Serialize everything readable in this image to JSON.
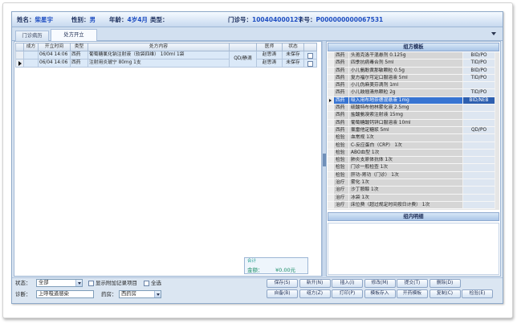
{
  "colors": {
    "accent": "#3774d2",
    "label_text": "#1c2f5e",
    "value_text": "#1f4fc2",
    "total_text": "#1a8d67",
    "window_bg": "#dbe6f2"
  },
  "icons": {
    "tab_menu": "chevron-down-icon",
    "current_row": "current-row-arrow-icon",
    "combo_arrow": "chevron-down-icon"
  },
  "patient": {
    "name_label": "姓名：",
    "name": "柴星宇",
    "gender_label": "性别：",
    "gender": "男",
    "age_label": "年龄：",
    "age": "4岁4月",
    "type_label": "类型：",
    "clinic_no_label": "门诊号：",
    "clinic_no": "100404000127",
    "card_no_label": "卡号：",
    "card_no": "P000000000067531"
  },
  "tabs": [
    {
      "label": "门诊病历",
      "active": false
    },
    {
      "label": "处方开立",
      "active": true
    }
  ],
  "orders": {
    "headers": {
      "set": "成方",
      "time": "开立时间",
      "type": "类型",
      "content": "处方内容",
      "doctor": "医师",
      "status": "状态"
    },
    "rows": [
      {
        "time": "06/04 14:06",
        "type": "西药",
        "content": "葡萄糖氯化钠注射液（软袋四维） 100ml 1袋",
        "usage": "QD/静滴",
        "doctor": "赵思涛",
        "status": "未保存",
        "checked": false,
        "current": false
      },
      {
        "time": "06/04 14:06",
        "type": "西药",
        "content": "注射用炎琥宁 80mg 1支",
        "doctor": "赵思涛",
        "status": "未保存",
        "checked": false,
        "current": true
      }
    ]
  },
  "total": {
    "title": "合计",
    "amount_label": "金额：",
    "amount": "¥0.00元"
  },
  "templates": {
    "title": "组方模板",
    "items": [
      {
        "type": "西药",
        "name": "头孢克洛干混悬剂 0.125g",
        "usage": "BID/PO"
      },
      {
        "type": "西药",
        "name": "四季抗病毒合剂 5ml",
        "usage": "TID/PO"
      },
      {
        "type": "西药",
        "name": "小儿氨酚黄那敏颗粒 0.5g",
        "usage": "BID/PO"
      },
      {
        "type": "西药",
        "name": "复方福尔可定口服溶液 5ml",
        "usage": "TID/PO"
      },
      {
        "type": "西药",
        "name": "小儿伪麻美芬滴剂 1ml"
      },
      {
        "type": "西药",
        "name": "小儿豉翘清热颗粒 2g",
        "usage": "TID/PO"
      },
      {
        "type": "西药",
        "name": "吸入用布地奈德混悬液 1mg",
        "usage": "BID/NEB",
        "selected": true
      },
      {
        "type": "西药",
        "name": "硫酸特布他林雾化液 2.5mg"
      },
      {
        "type": "西药",
        "name": "盐酸氨溴索注射液 15mg"
      },
      {
        "type": "西药",
        "name": "葡萄糖酸钙锌口服溶液 10ml"
      },
      {
        "type": "西药",
        "name": "氯雷他定糖浆 5ml",
        "usage": "QD/PO"
      },
      {
        "type": "检验",
        "name": "血常规 1次"
      },
      {
        "type": "检验",
        "name": "C-反应蛋白（CRP） 1次"
      },
      {
        "type": "检验",
        "name": "ABO血型 1次"
      },
      {
        "type": "检验",
        "name": "肺炎支原体抗体 1次"
      },
      {
        "type": "检验",
        "name": "门诊一般检查 1次"
      },
      {
        "type": "检验",
        "name": "肝功-肾功（门诊） 1次"
      },
      {
        "type": "治疗",
        "name": "雾化 1次"
      },
      {
        "type": "治疗",
        "name": "沙丁胺醇 1次"
      },
      {
        "type": "治疗",
        "name": "冰袋 1次"
      },
      {
        "type": "治疗",
        "name": "床位费（超过规定时间按日计费） 1次"
      }
    ]
  },
  "group_detail": {
    "title": "组内明细"
  },
  "filters": {
    "status_label": "状态：",
    "status_value": "全部",
    "show_extra_label": "显示附加记录项目",
    "show_extra_checked": false,
    "select_all_label": "全选",
    "select_all_checked": false,
    "diagnosis_label": "诊断：",
    "diagnosis_value": "上呼吸道感染",
    "pharmacy_label": "药房：",
    "pharmacy_value": "西药房"
  },
  "buttons": {
    "row1": [
      {
        "label": "保存(S)"
      },
      {
        "label": "新开(N)"
      },
      {
        "label": "插入(I)"
      },
      {
        "label": "修改(M)"
      },
      {
        "label": "提交(T)"
      },
      {
        "label": "删除(D)"
      }
    ],
    "row2": [
      {
        "label": "自备(B)"
      },
      {
        "label": "组方(Z)"
      },
      {
        "label": "打印(P)"
      },
      {
        "label": "模板存入"
      },
      {
        "label": "开药模板"
      },
      {
        "label": "复制(C)"
      },
      {
        "label": "检验(E)"
      }
    ]
  }
}
